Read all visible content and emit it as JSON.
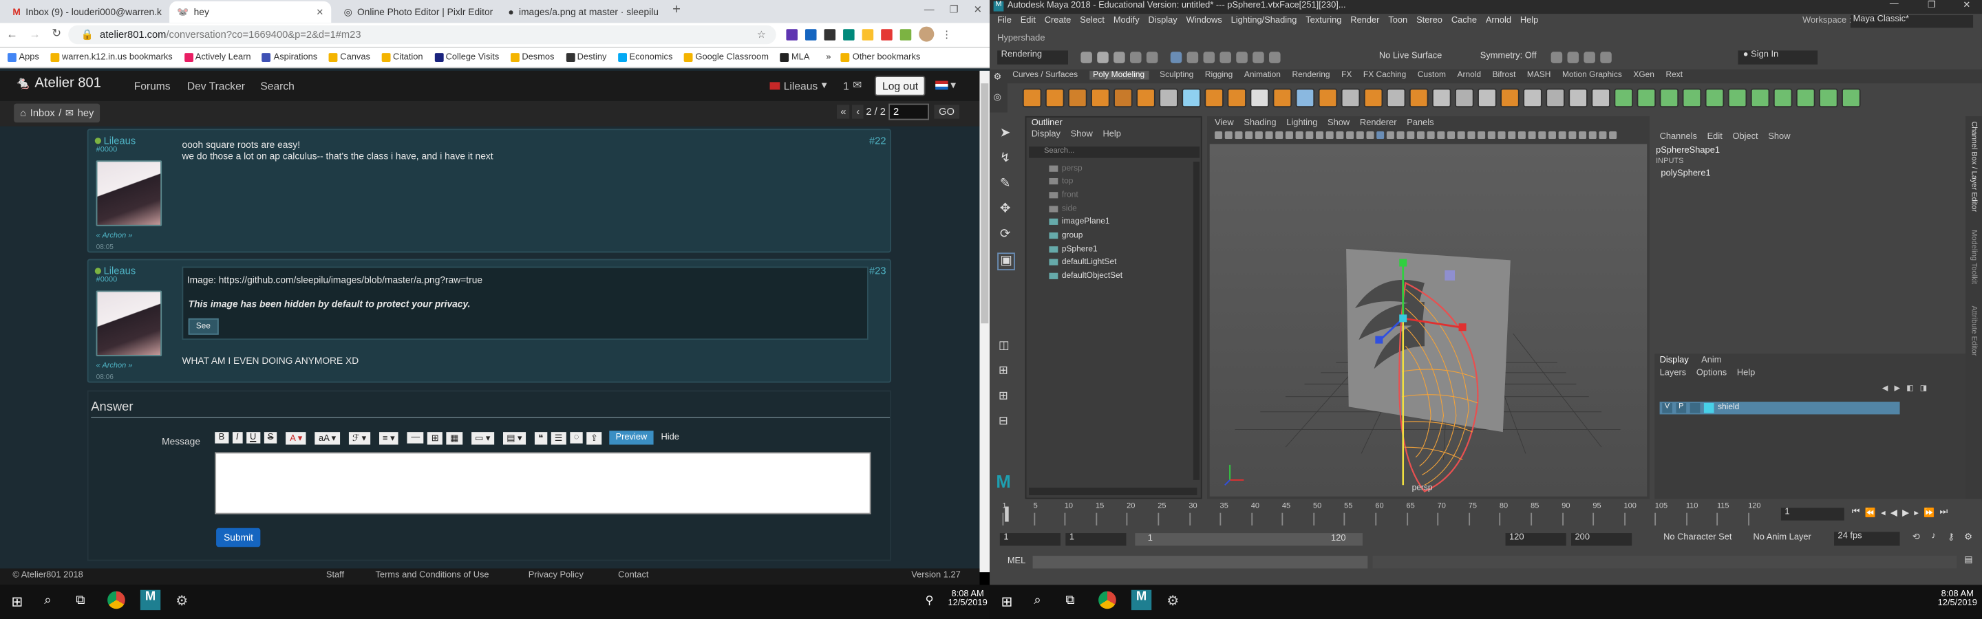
{
  "chrome": {
    "tabs": [
      {
        "label": "Inbox (9) - louderi000@warren.k",
        "icon": "gmail-icon"
      },
      {
        "label": "hey",
        "icon": "site-icon"
      },
      {
        "label": "Online Photo Editor | Pixlr Editor",
        "icon": "globe-icon"
      },
      {
        "label": "images/a.png at master · sleepilu",
        "icon": "github-icon"
      }
    ],
    "url_host": "atelier801.com",
    "url_path": "/conversation?co=1669400&p=2&d=1#m23",
    "bookmarks": [
      "Apps",
      "warren.k12.in.us bookmarks",
      "Actively Learn",
      "Aspirations",
      "Canvas",
      "Citation",
      "College Visits",
      "Desmos",
      "Destiny",
      "Economics",
      "Google Classroom",
      "MLA",
      "Other bookmarks"
    ]
  },
  "site": {
    "brand": "Atelier 801",
    "nav": [
      "Forums",
      "Dev Tracker",
      "Search"
    ],
    "user": "Lileaus",
    "count": "1",
    "logout": "Log out",
    "breadcrumb_inbox": "Inbox",
    "breadcrumb_thread": "hey",
    "page_indicator": "2 / 2",
    "page_input": "2",
    "go": "GO",
    "pager_first": "«",
    "pager_prev": "‹",
    "posts": [
      {
        "author": "Lileaus",
        "tag": "#0000",
        "role": "« Archon »",
        "time": "08:05",
        "num": "#22",
        "lines": [
          "oooh square roots are easy!",
          "we do those a lot on ap calculus-- that's the class i have, and i have it next"
        ]
      },
      {
        "author": "Lileaus",
        "tag": "#0000",
        "role": "« Archon »",
        "time": "08:06",
        "num": "#23",
        "image_label": "Image: https://github.com/sleepilu/images/blob/master/a.png?raw=true",
        "hidden_note": "This image has been hidden by default to protect your privacy.",
        "see": "See",
        "after": "WHAT AM I EVEN DOING ANYMORE XD"
      }
    ],
    "answer_title": "Answer",
    "message_label": "Message",
    "preview": "Preview",
    "hide": "Hide",
    "submit": "Submit",
    "footer_copy": "© Atelier801 2018",
    "footer_links": [
      "Staff",
      "Terms and Conditions of Use",
      "Privacy Policy",
      "Contact"
    ],
    "version": "Version 1.27"
  },
  "taskbar_left": {
    "time": "8:08 AM",
    "date": "12/5/2019"
  },
  "maya": {
    "title": "Autodesk Maya 2018 - Educational Version: untitled*   ---   pSphere1.vtxFace[251][230]...",
    "menus": [
      "File",
      "Edit",
      "Create",
      "Select",
      "Modify",
      "Display",
      "Windows",
      "Lighting/Shading",
      "Texturing",
      "Render",
      "Toon",
      "Stereo",
      "Cache",
      "Arnold",
      "Help"
    ],
    "workspace_label": "Workspace :",
    "workspace_value": "Maya Classic*",
    "hypershade": "Hypershade",
    "mode": "Rendering",
    "live_surface": "No Live Surface",
    "symmetry": "Symmetry: Off",
    "sign_in": "Sign In",
    "shelf_tabs": [
      "Curves / Surfaces",
      "Poly Modeling",
      "Sculpting",
      "Rigging",
      "Animation",
      "Rendering",
      "FX",
      "FX Caching",
      "Custom",
      "Arnold",
      "Bifrost",
      "MASH",
      "Motion Graphics",
      "XGen",
      "Rext"
    ],
    "outliner_title": "Outliner",
    "outliner_menus": [
      "Display",
      "Show",
      "Help"
    ],
    "outliner_search": "Search...",
    "outliner_items": [
      {
        "label": "persp",
        "dim": true
      },
      {
        "label": "top",
        "dim": true
      },
      {
        "label": "front",
        "dim": true
      },
      {
        "label": "side",
        "dim": true
      },
      {
        "label": "imagePlane1",
        "dim": false
      },
      {
        "label": "group",
        "dim": false
      },
      {
        "label": "pSphere1",
        "dim": false
      },
      {
        "label": "defaultLightSet",
        "dim": false
      },
      {
        "label": "defaultObjectSet",
        "dim": false
      }
    ],
    "viewport_menus": [
      "View",
      "Shading",
      "Lighting",
      "Show",
      "Renderer",
      "Panels"
    ],
    "camera_label": "persp",
    "channel_menus": [
      "Channels",
      "Edit",
      "Object",
      "Show"
    ],
    "channel_lines": [
      "pSphereShape1",
      "INPUTS",
      "polySphere1"
    ],
    "layer_tabs": [
      "Display",
      "Anim"
    ],
    "layer_menus": [
      "Layers",
      "Options",
      "Help"
    ],
    "layer_name": "shield",
    "layer_v": "V",
    "layer_p": "P",
    "side_tabs": [
      "Channel Box / Layer Editor",
      "Modeling Toolkit",
      "Attribute Editor"
    ],
    "timeline_ticks": [
      "1",
      "5",
      "10",
      "15",
      "20",
      "25",
      "30",
      "35",
      "40",
      "45",
      "50",
      "55",
      "60",
      "65",
      "70",
      "75",
      "80",
      "85",
      "90",
      "95",
      "100",
      "105",
      "110",
      "115",
      "120"
    ],
    "current_frame": "1",
    "range_start": "1",
    "range_start2": "1",
    "range_slider_start": "1",
    "range_slider_end": "120",
    "range_end": "120",
    "range_end2": "200",
    "char_set": "No Character Set",
    "anim_layer": "No Anim Layer",
    "fps": "24 fps",
    "mel": "MEL"
  },
  "taskbar_right": {
    "time": "8:08 AM",
    "date": "12/5/2019"
  }
}
